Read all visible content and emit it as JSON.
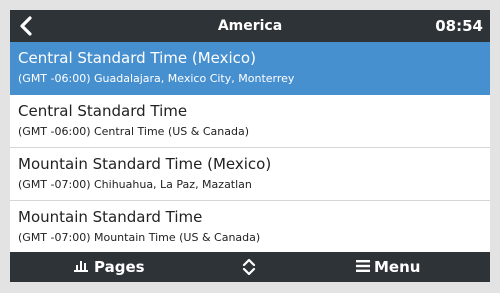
{
  "header": {
    "title": "America",
    "time": "08:54",
    "back_icon": "chevron-left-icon"
  },
  "list": {
    "items": [
      {
        "name": "Central Standard Time (Mexico)",
        "detail": "(GMT -06:00) Guadalajara, Mexico City, Monterrey",
        "selected": true
      },
      {
        "name": "Central Standard Time",
        "detail": "(GMT -06:00) Central Time (US & Canada)",
        "selected": false
      },
      {
        "name": "Mountain Standard Time (Mexico)",
        "detail": "(GMT -07:00) Chihuahua, La Paz, Mazatlan",
        "selected": false
      },
      {
        "name": "Mountain Standard Time",
        "detail": "(GMT -07:00) Mountain Time (US & Canada)",
        "selected": false
      }
    ]
  },
  "footer": {
    "pages_label": "Pages",
    "menu_label": "Menu",
    "pages_icon": "bar-chart-icon",
    "updown_icon": "up-down-arrows-icon",
    "menu_icon": "hamburger-menu-icon"
  },
  "colors": {
    "bar_background": "#2d3337",
    "selected_row": "#4790d0",
    "row_background": "#ffffff",
    "outer_background": "#e3e3e3"
  }
}
